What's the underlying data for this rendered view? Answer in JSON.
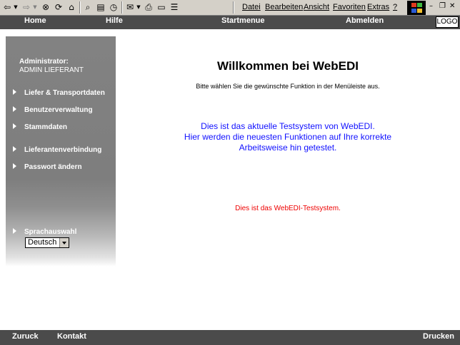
{
  "browser": {
    "menu": [
      "Datei",
      "Bearbeiten",
      "Ansicht",
      "Favoriten",
      "Extras",
      "?"
    ],
    "icons": [
      "back-icon",
      "forward-icon",
      "stop-icon",
      "refresh-icon",
      "home-icon",
      "search-icon",
      "favorites-icon",
      "history-icon",
      "mail-icon",
      "print-icon",
      "edit-icon",
      "discuss-icon"
    ]
  },
  "topnav": {
    "home": "Home",
    "help": "Hilfe",
    "start_menu": "Startmenue",
    "logout": "Abmelden",
    "logo": "LOGO"
  },
  "sidebar": {
    "role": "Administrator:",
    "user": "ADMIN LIEFERANT",
    "items": [
      {
        "label": "Liefer & Transportdaten"
      },
      {
        "label": "Benutzerverwaltung"
      },
      {
        "label": "Stammdaten"
      },
      {
        "label": "Lieferantenverbindung"
      },
      {
        "label": "Passwort ändern"
      }
    ],
    "language_label": "Sprachauswahl",
    "language_value": "Deutsch"
  },
  "main": {
    "title": "Willkommen bei WebEDI",
    "subtitle": "Bitte wählen Sie die gewünschte Funktion in der Menüleiste aus.",
    "info_lines": [
      "Dies ist das aktuelle Testsystem von WebEDI.",
      "Hier werden die neuesten Funktionen auf Ihre korrekte",
      "Arbeitsweise hin getestet."
    ],
    "notice": "Dies ist das WebEDI-Testsystem."
  },
  "footer": {
    "back": "Zuruck",
    "contact": "Kontakt",
    "print": "Drucken"
  },
  "colors": {
    "nav_bg": "#4b4b4b",
    "info_text": "#1010ff",
    "notice_text": "#ee0000"
  }
}
